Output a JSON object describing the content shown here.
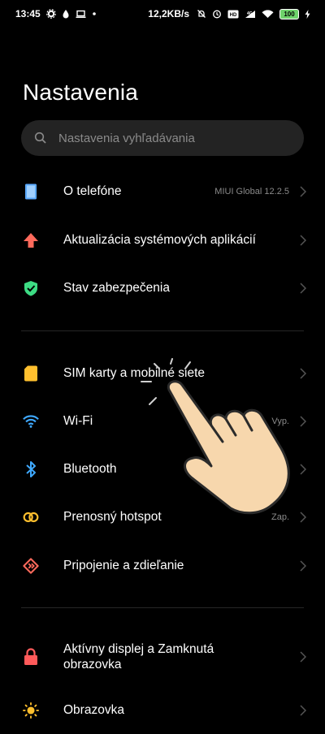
{
  "status_bar": {
    "time": "13:45",
    "network_speed": "12,2KB/s",
    "battery_level": "100",
    "icons": [
      "gear-icon",
      "drop-icon",
      "laptop-icon",
      "dot-icon",
      "mute-bell-icon",
      "alarm-icon",
      "volte-icon",
      "signal-icon",
      "wifi-icon",
      "battery-icon",
      "charging-icon"
    ]
  },
  "page": {
    "title": "Nastavenia"
  },
  "search": {
    "placeholder": "Nastavenia vyhľadávania"
  },
  "sections": [
    {
      "items": [
        {
          "label": "O telefóne",
          "value": "MIUI Global 12.2.5",
          "icon": "phone-info-icon",
          "color": "#5aa9ff"
        },
        {
          "label": "Aktualizácia systémových aplikácií",
          "value": "",
          "icon": "update-arrow-icon",
          "color": "#ff6a5c"
        },
        {
          "label": "Stav zabezpečenia",
          "value": "",
          "icon": "shield-check-icon",
          "color": "#3ddc84"
        }
      ]
    },
    {
      "items": [
        {
          "label": "SIM karty a mobilné siete",
          "value": "",
          "icon": "sim-card-icon",
          "color": "#ffc02e"
        },
        {
          "label": "Wi-Fi",
          "value": "Vyp.",
          "icon": "wifi-icon",
          "color": "#3fa9ff"
        },
        {
          "label": "Bluetooth",
          "value": "",
          "icon": "bluetooth-icon",
          "color": "#3fa9ff"
        },
        {
          "label": "Prenosný hotspot",
          "value": "Zap.",
          "icon": "hotspot-icon",
          "color": "#ffc02e"
        },
        {
          "label": "Pripojenie a zdieľanie",
          "value": "",
          "icon": "connection-share-icon",
          "color": "#ff6a5c"
        }
      ]
    },
    {
      "items": [
        {
          "label": "Aktívny displej a Zamknutá",
          "label_line2": "obrazovka",
          "value": "",
          "icon": "lock-icon",
          "color": "#ff5a5a"
        },
        {
          "label": "Obrazovka",
          "value": "",
          "icon": "brightness-icon",
          "color": "#ffc02e"
        }
      ]
    }
  ],
  "overlay": {
    "icon": "tap-hand-icon"
  }
}
